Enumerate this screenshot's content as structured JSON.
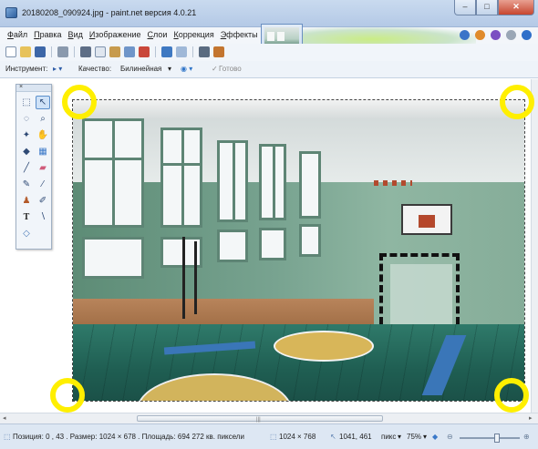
{
  "window": {
    "title": "20180208_090924.jpg - paint.net версия 4.0.21",
    "minimize_label": "–",
    "maximize_label": "□",
    "close_label": "✕"
  },
  "menu": {
    "items": [
      {
        "first": "Ф",
        "rest": "айл"
      },
      {
        "first": "П",
        "rest": "равка"
      },
      {
        "first": "В",
        "rest": "ид"
      },
      {
        "first": "И",
        "rest": "зображение"
      },
      {
        "first": "С",
        "rest": "лои"
      },
      {
        "first": "К",
        "rest": "оррекция"
      },
      {
        "first": "Э",
        "rest": "ффекты"
      }
    ]
  },
  "options_bar": {
    "tool_label": "Инструмент:",
    "quality_label": "Качество:",
    "quality_value": "Билинейная",
    "done_label": "Готово"
  },
  "tools_panel": {
    "close_glyph": "×",
    "icons": [
      "move-selection-icon",
      "move-selected-icon",
      "lasso-icon",
      "zoom-icon",
      "magic-wand-icon",
      "pan-icon",
      "paint-bucket-icon",
      "gradient-icon",
      "paintbrush-icon",
      "eraser-icon",
      "pencil-icon",
      "color-picker-icon",
      "clone-stamp-icon",
      "recolor-icon",
      "text-icon",
      "line-curve-icon",
      "shapes-icon"
    ]
  },
  "statusbar": {
    "position_text": "Позиция: 0 , 43 . Размер: 1024 × 678 . Площадь: 694 272 кв. пиксели",
    "image_size": "1024 × 768",
    "cursor_pos": "1041, 461",
    "units": "пикс",
    "zoom": "75%"
  },
  "scroll": {
    "left_arrow": "◂",
    "right_arrow": "▸",
    "grip": "|||"
  },
  "colors": {
    "highlight_ring": "#ffef00",
    "titlebar": "#c9daef"
  }
}
